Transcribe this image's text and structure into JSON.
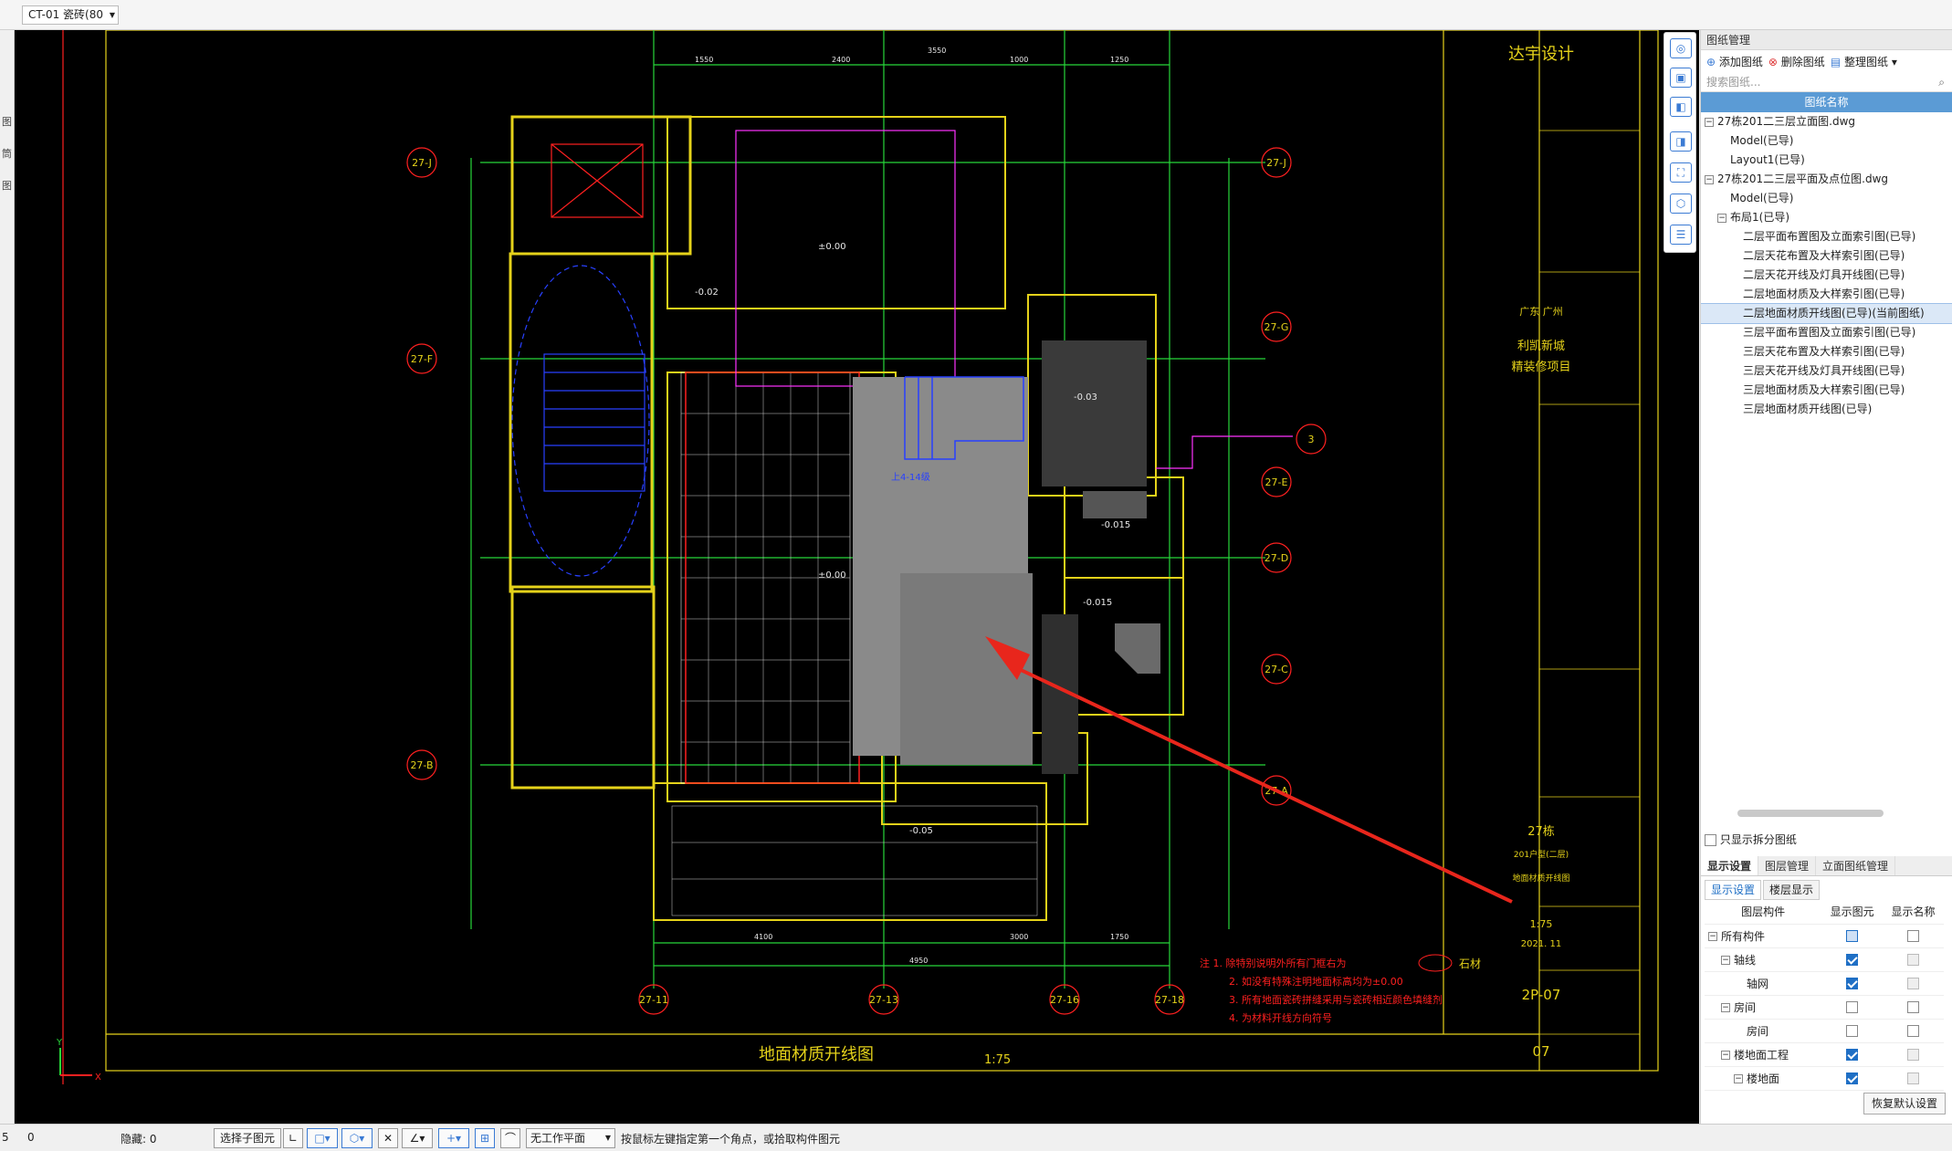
{
  "topbar": {
    "combo_value": "CT-01 瓷砖(80"
  },
  "left_strip": [
    "图",
    "筒",
    "图"
  ],
  "drawing": {
    "axis_left": [
      "27-J",
      "27-F",
      "27-B"
    ],
    "axis_right": [
      "27-J",
      "27-G",
      "27-E",
      "27-D",
      "27-C",
      "27-A"
    ],
    "axis_bottom": [
      "27-11",
      "27-13",
      "27-16",
      "27-18"
    ],
    "axis_misc": "3",
    "title": "地面材质开线图",
    "scale": "1:75",
    "notes": [
      "注 1. 除特别说明外所有门框右为",
      "2. 如没有特殊注明地面标高均为±0.00",
      "3. 所有地面瓷砖拼缝采用与瓷砖相近颜色填缝剂",
      "4.    为材料开线方向符号"
    ],
    "legend": "石材",
    "room_labels": [
      "±0.00",
      "-0.02",
      "-0.05",
      "±0.00",
      "上4-14级",
      "-0.015",
      "-0.015",
      "-0.03"
    ],
    "dims_top": [
      "1550",
      "2400",
      "3550",
      "1000",
      "1250"
    ],
    "dims_bottom": [
      "4100",
      "4950",
      "1750",
      "3000"
    ],
    "title_block": {
      "logo": "达宇设计",
      "region": "广东 广州",
      "project1": "利凯新城",
      "project2": "精装修项目",
      "building": "27栋",
      "unit": "201户型(二层)",
      "sheet_title": "地面材质开线图",
      "scale": "1:75",
      "date": "2021. 11",
      "drawing_no": "2P-07",
      "page_no": "07"
    }
  },
  "vertical_tools": [
    "orbit-icon",
    "top-view-icon",
    "front-view-icon",
    "side-view-icon",
    "fit-icon",
    "layer-icon",
    "list-icon"
  ],
  "drawing_manager": {
    "title": "图纸管理",
    "actions": [
      "添加图纸",
      "删除图纸",
      "整理图纸"
    ],
    "search_placeholder": "搜索图纸...",
    "column": "图纸名称",
    "items": [
      {
        "label": "27栋201二三层立面图.dwg",
        "level": 0,
        "toggle": "−"
      },
      {
        "label": "Model(已导)",
        "level": 1
      },
      {
        "label": "Layout1(已导)",
        "level": 1
      },
      {
        "label": "27栋201二三层平面及点位图.dwg",
        "level": 0,
        "toggle": "−"
      },
      {
        "label": "Model(已导)",
        "level": 1
      },
      {
        "label": "布局1(已导)",
        "level": 1,
        "toggle": "−"
      },
      {
        "label": "二层平面布置图及立面索引图(已导)",
        "level": 2
      },
      {
        "label": "二层天花布置及大样索引图(已导)",
        "level": 2
      },
      {
        "label": "二层天花开线及灯具开线图(已导)",
        "level": 2
      },
      {
        "label": "二层地面材质及大样索引图(已导)",
        "level": 2
      },
      {
        "label": "二层地面材质开线图(已导)(当前图纸)",
        "level": 2,
        "selected": true
      },
      {
        "label": "三层平面布置图及立面索引图(已导)",
        "level": 2
      },
      {
        "label": "三层天花布置及大样索引图(已导)",
        "level": 2
      },
      {
        "label": "三层天花开线及灯具开线图(已导)",
        "level": 2
      },
      {
        "label": "三层地面材质及大样索引图(已导)",
        "level": 2
      },
      {
        "label": "三层地面材质开线图(已导)",
        "level": 2
      }
    ],
    "only_split": "只显示拆分图纸"
  },
  "display_panel": {
    "tabs": [
      "显示设置",
      "图层管理",
      "立面图纸管理"
    ],
    "subtabs": [
      "显示设置",
      "楼层显示"
    ],
    "headers": [
      "图层构件",
      "显示图元",
      "显示名称"
    ],
    "rows": [
      {
        "label": "所有构件",
        "indent": 0,
        "toggle": "−",
        "show": "partial",
        "name": false
      },
      {
        "label": "轴线",
        "indent": 1,
        "toggle": "−",
        "show": true,
        "name": false
      },
      {
        "label": "轴网",
        "indent": 2,
        "show": true,
        "name": false
      },
      {
        "label": "房间",
        "indent": 1,
        "toggle": "−",
        "show": false,
        "name": false
      },
      {
        "label": "房间",
        "indent": 2,
        "show": false,
        "name": false
      },
      {
        "label": "楼地面工程",
        "indent": 1,
        "toggle": "−",
        "show": true,
        "name": false
      },
      {
        "label": "楼地面",
        "indent": 2,
        "toggle": "−",
        "show": true,
        "name": false
      }
    ],
    "restore": "恢复默认设置"
  },
  "status": {
    "left1": "5",
    "left2": "0",
    "hidden": "隐藏: 0",
    "select_child": "选择子图元",
    "workplane": "无工作平面",
    "hint": "按鼠标左键指定第一个角点，或拾取构件图元"
  },
  "colors": {
    "canvas": "#000000",
    "cad_yellow": "#e5d21a",
    "cad_green": "#27d63a",
    "cad_red": "#ff2020",
    "cad_magenta": "#ff33ff",
    "arrow": "#e8261c",
    "accent": "#5b9bd5"
  }
}
